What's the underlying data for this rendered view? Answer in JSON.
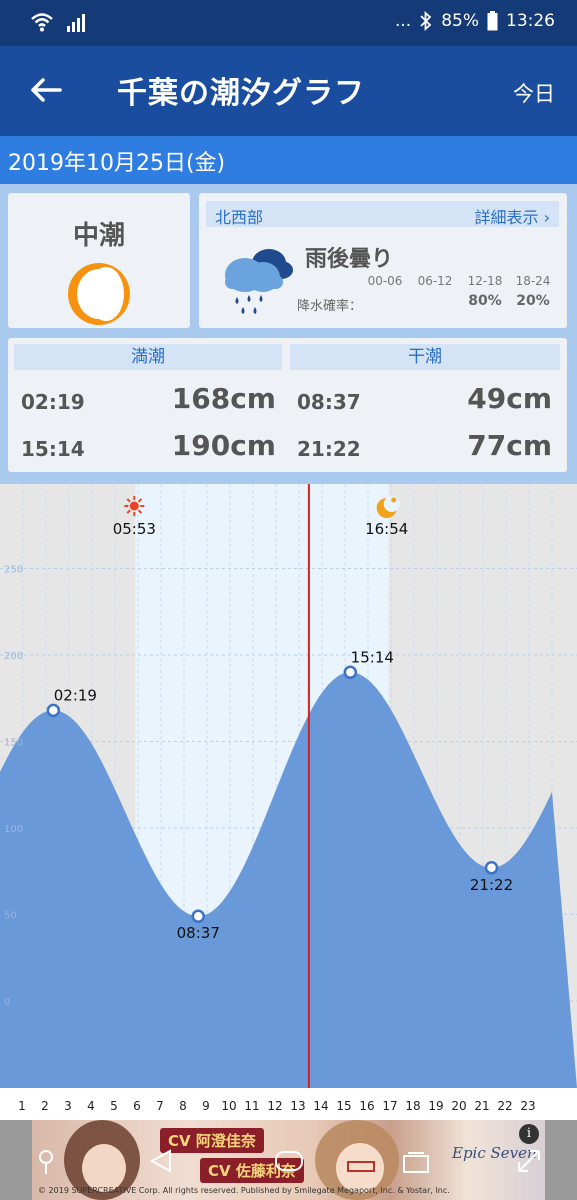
{
  "status_bar": {
    "battery": "85%",
    "time": "13:26",
    "more": "..."
  },
  "app_bar": {
    "title": "千葉の潮汐グラフ",
    "today_label": "今日"
  },
  "date_label": "2019年10月25日(金)",
  "tide_type": "中潮",
  "weather": {
    "region": "北西部",
    "detail_label": "詳細表示",
    "forecast": "雨後曇り",
    "precip_label": "降水確率：",
    "periods": [
      "00-06",
      "06-12",
      "12-18",
      "18-24"
    ],
    "precip_values": [
      "",
      "",
      "80%",
      "20%"
    ]
  },
  "high_tide": {
    "header": "満潮",
    "entries": [
      {
        "time": "02:19",
        "height": "168cm"
      },
      {
        "time": "15:14",
        "height": "190cm"
      }
    ]
  },
  "low_tide": {
    "header": "干潮",
    "entries": [
      {
        "time": "08:37",
        "height": "49cm"
      },
      {
        "time": "21:22",
        "height": "77cm"
      }
    ]
  },
  "chart_data": {
    "type": "area",
    "ylim": [
      -50,
      300
    ],
    "xlim": [
      0,
      24
    ],
    "y_ticks": [
      0,
      50,
      100,
      150,
      200,
      250
    ],
    "x_ticks": [
      "1",
      "2",
      "3",
      "4",
      "5",
      "6",
      "7",
      "8",
      "9",
      "10",
      "11",
      "12",
      "13",
      "14",
      "15",
      "16",
      "17",
      "18",
      "19",
      "20",
      "21",
      "22",
      "23"
    ],
    "sunrise": "05:53",
    "sunset": "16:54",
    "current_hour": 13.43,
    "extrema": [
      {
        "time": "02:19",
        "x": 2.32,
        "y": 168,
        "label_pos": "above"
      },
      {
        "time": "08:37",
        "x": 8.62,
        "y": 49,
        "label_pos": "below"
      },
      {
        "time": "15:14",
        "x": 15.23,
        "y": 190,
        "label_pos": "above"
      },
      {
        "time": "21:22",
        "x": 21.37,
        "y": 77,
        "label_pos": "below"
      }
    ],
    "colors": {
      "fill": "#6a99da",
      "night_bg": "#e6e6e6",
      "day_bg": "#e9f4fc",
      "now_line": "#d62020"
    }
  },
  "ad": {
    "tag1": "CV 阿澄佳奈",
    "tag2": "CV 佐藤利奈",
    "copyright": "© 2019 SUPERCREATIVE Corp. All rights reserved. Published by Smilegate Megaport, Inc. & Yostar, Inc.",
    "logo_text": "Epic Seven",
    "info": "i"
  }
}
